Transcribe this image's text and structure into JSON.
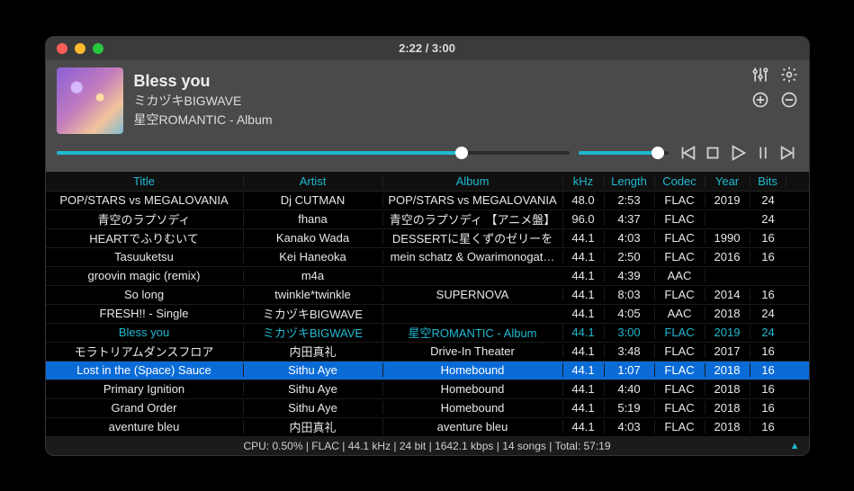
{
  "titlebar": {
    "title": "2:22 / 3:00"
  },
  "nowplaying": {
    "title": "Bless you",
    "artist": "ミカヅキBIGWAVE",
    "album": "星空ROMANTIC - Album"
  },
  "controls": {
    "seek_percent": 79,
    "volume_percent": 88
  },
  "columns": {
    "title": "Title",
    "artist": "Artist",
    "album": "Album",
    "khz": "kHz",
    "length": "Length",
    "codec": "Codec",
    "year": "Year",
    "bits": "Bits"
  },
  "tracks": [
    {
      "title": "POP/STARS vs MEGALOVANIA",
      "artist": "Dj CUTMAN",
      "album": "POP/STARS vs MEGALOVANIA",
      "khz": "48.0",
      "length": "2:53",
      "codec": "FLAC",
      "year": "2019",
      "bits": "24"
    },
    {
      "title": "青空のラプソディ",
      "artist": "fhana",
      "album": "青空のラプソディ 【アニメ盤】",
      "khz": "96.0",
      "length": "4:37",
      "codec": "FLAC",
      "year": "",
      "bits": "24"
    },
    {
      "title": "HEARTでふりむいて",
      "artist": "Kanako Wada",
      "album": "DESSERTに星くずのゼリーを",
      "khz": "44.1",
      "length": "4:03",
      "codec": "FLAC",
      "year": "1990",
      "bits": "16"
    },
    {
      "title": "Tasuuketsu",
      "artist": "Kei Haneoka",
      "album": "mein schatz & Owarimonogat…",
      "khz": "44.1",
      "length": "2:50",
      "codec": "FLAC",
      "year": "2016",
      "bits": "16"
    },
    {
      "title": "groovin magic (remix)",
      "artist": "m4a",
      "album": "",
      "khz": "44.1",
      "length": "4:39",
      "codec": "AAC",
      "year": "",
      "bits": ""
    },
    {
      "title": "So long",
      "artist": "twinkle*twinkle",
      "album": "SUPERNOVA",
      "khz": "44.1",
      "length": "8:03",
      "codec": "FLAC",
      "year": "2014",
      "bits": "16"
    },
    {
      "title": "FRESH!! - Single",
      "artist": "ミカヅキBIGWAVE",
      "album": "",
      "khz": "44.1",
      "length": "4:05",
      "codec": "AAC",
      "year": "2018",
      "bits": "24"
    },
    {
      "title": "Bless you",
      "artist": "ミカヅキBIGWAVE",
      "album": "星空ROMANTIC - Album",
      "khz": "44.1",
      "length": "3:00",
      "codec": "FLAC",
      "year": "2019",
      "bits": "24",
      "playing": true
    },
    {
      "title": "モラトリアムダンスフロア",
      "artist": "内田真礼",
      "album": "Drive-In Theater",
      "khz": "44.1",
      "length": "3:48",
      "codec": "FLAC",
      "year": "2017",
      "bits": "16"
    },
    {
      "title": "Lost in the (Space) Sauce",
      "artist": "Sithu Aye",
      "album": "Homebound",
      "khz": "44.1",
      "length": "1:07",
      "codec": "FLAC",
      "year": "2018",
      "bits": "16",
      "selected": true
    },
    {
      "title": "Primary Ignition",
      "artist": "Sithu Aye",
      "album": "Homebound",
      "khz": "44.1",
      "length": "4:40",
      "codec": "FLAC",
      "year": "2018",
      "bits": "16"
    },
    {
      "title": "Grand Order",
      "artist": "Sithu Aye",
      "album": "Homebound",
      "khz": "44.1",
      "length": "5:19",
      "codec": "FLAC",
      "year": "2018",
      "bits": "16"
    },
    {
      "title": "aventure bleu",
      "artist": "内田真礼",
      "album": "aventure bleu",
      "khz": "44.1",
      "length": "4:03",
      "codec": "FLAC",
      "year": "2018",
      "bits": "16"
    }
  ],
  "status": {
    "text": "CPU: 0.50% | FLAC | 44.1 kHz | 24 bit | 1642.1 kbps | 14 songs | Total: 57:19"
  }
}
